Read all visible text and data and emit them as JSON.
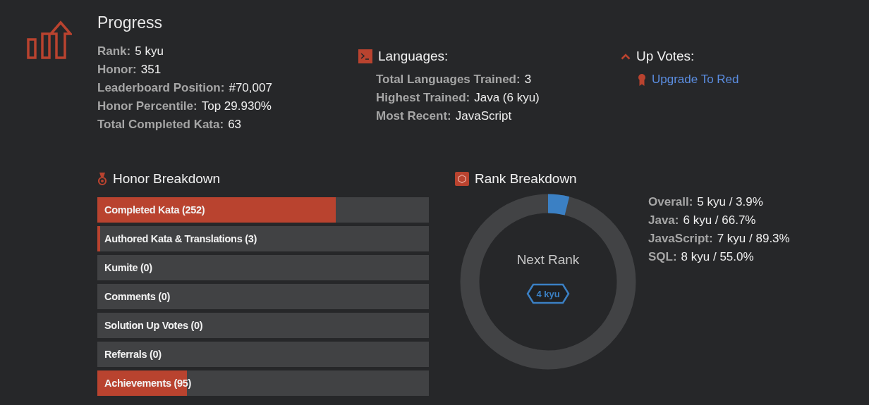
{
  "progress": {
    "title": "Progress",
    "stats": [
      {
        "label": "Rank:",
        "value": "5 kyu"
      },
      {
        "label": "Honor:",
        "value": "351"
      },
      {
        "label": "Leaderboard Position:",
        "value": "#70,007"
      },
      {
        "label": "Honor Percentile:",
        "value": "Top 29.930%"
      },
      {
        "label": "Total Completed Kata:",
        "value": "63"
      }
    ]
  },
  "languages": {
    "title": "Languages:",
    "stats": [
      {
        "label": "Total Languages Trained:",
        "value": "3"
      },
      {
        "label": "Highest Trained:",
        "value": "Java (6 kyu)"
      },
      {
        "label": "Most Recent:",
        "value": "JavaScript"
      }
    ]
  },
  "up_votes": {
    "title": "Up Votes:",
    "link": "Upgrade To Red"
  },
  "honor_breakdown": {
    "title": "Honor Breakdown",
    "bars": [
      {
        "label": "Completed Kata (252)",
        "level": 0.72
      },
      {
        "label": "Authored Kata & Translations (3)",
        "level": 0.008
      },
      {
        "label": "Kumite (0)"
      },
      {
        "label": "Comments (0)"
      },
      {
        "label": "Solution Up Votes (0)"
      },
      {
        "label": "Referrals (0)"
      },
      {
        "label": "Achievements (95)",
        "level": 0.27
      }
    ]
  },
  "rank_breakdown": {
    "title": "Rank Breakdown",
    "center_label": "Next Rank",
    "next_rank": "4 kyu",
    "level": 0.039,
    "stats": [
      {
        "label": "Overall:",
        "value": "5 kyu / 3.9%"
      },
      {
        "label": "Java:",
        "value": "6 kyu / 66.7%"
      },
      {
        "label": "JavaScript:",
        "value": "7 kyu / 89.3%"
      },
      {
        "label": "SQL:",
        "value": "8 kyu / 55.0%"
      }
    ]
  }
}
